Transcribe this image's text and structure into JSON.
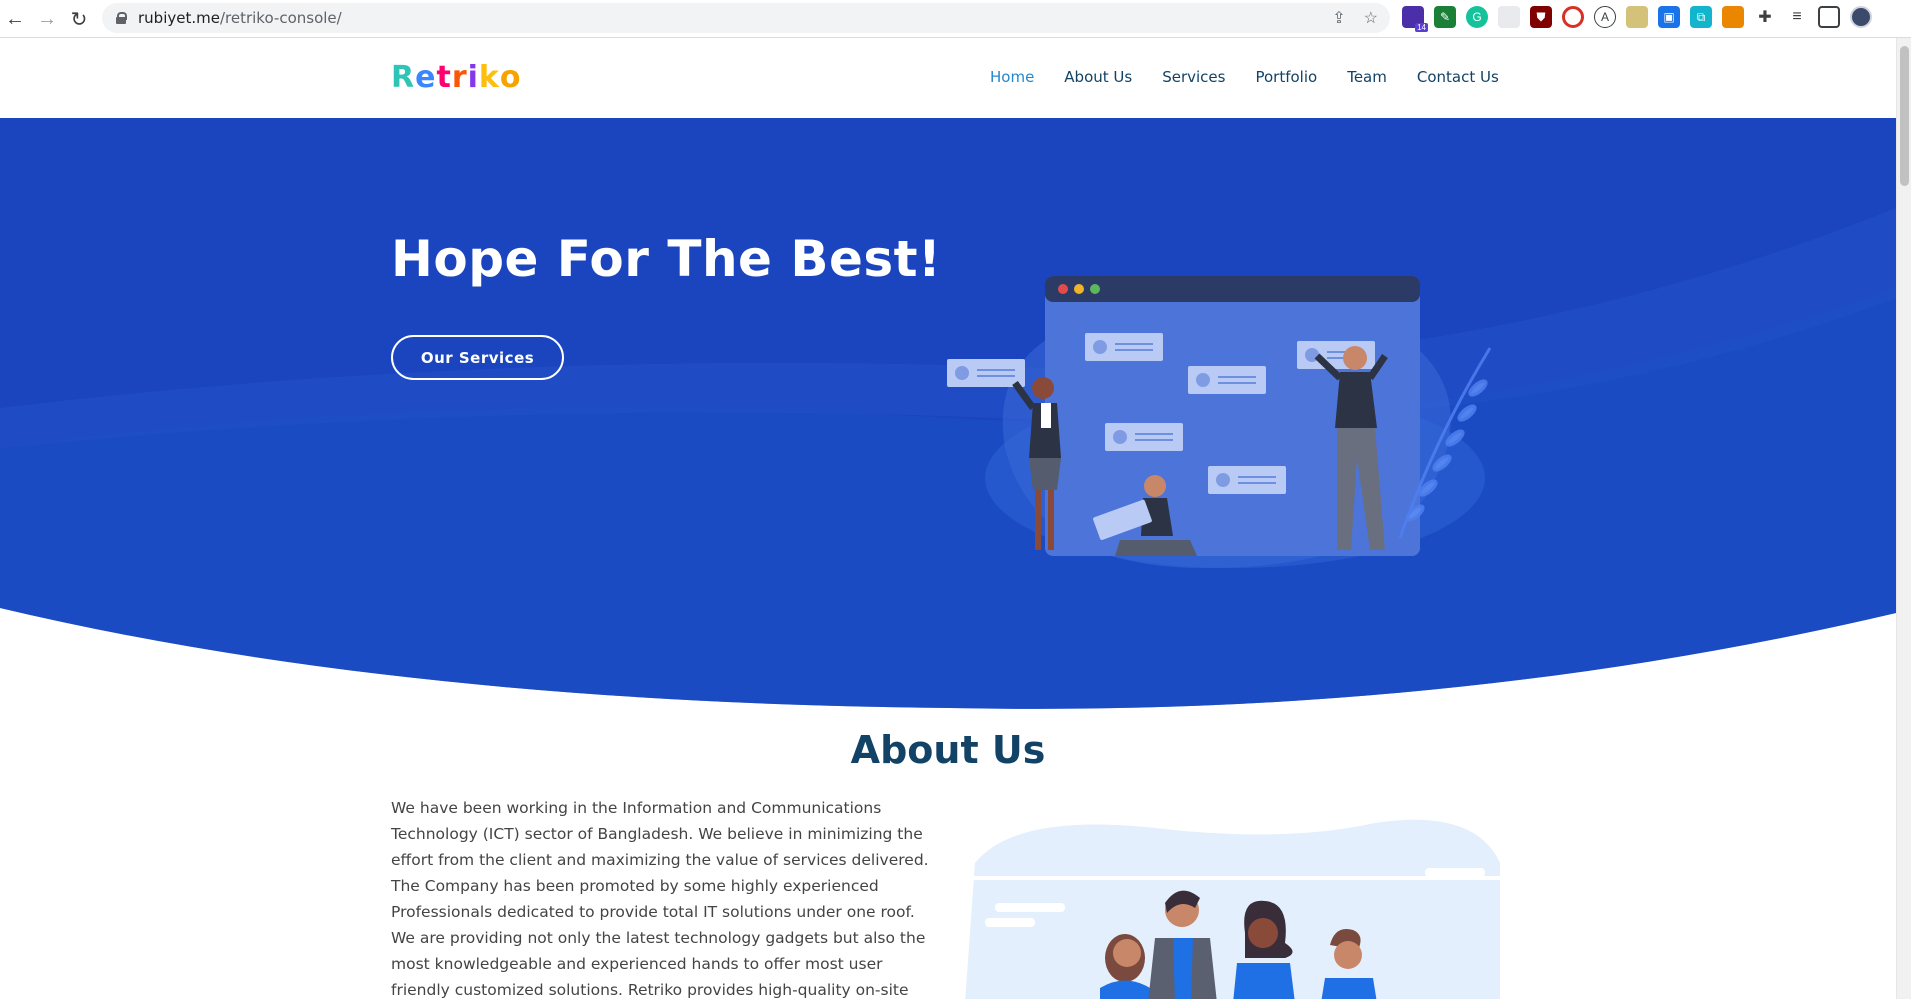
{
  "browser": {
    "url_host": "rubiyet.me",
    "url_path": "/retriko-console/",
    "extension_badge": "14"
  },
  "site": {
    "logo": "Retriko",
    "logo_colors": [
      "#2ec4b6",
      "#3a86ff",
      "#ff006e",
      "#fb5607",
      "#8338ec",
      "#ffbe0b",
      "#06d6a0"
    ],
    "nav": [
      {
        "label": "Home",
        "active": true
      },
      {
        "label": "About Us",
        "active": false
      },
      {
        "label": "Services",
        "active": false
      },
      {
        "label": "Portfolio",
        "active": false
      },
      {
        "label": "Team",
        "active": false
      },
      {
        "label": "Contact Us",
        "active": false
      }
    ],
    "hero": {
      "title": "Hope For The Best!",
      "button": "Our Services",
      "bg_color": "#1a45be"
    },
    "about": {
      "title": "About Us",
      "text": "We have been working in the Information and Communications Technology (ICT) sector of Bangladesh. We believe in minimizing the effort from the client and maximizing the value of services delivered. The Company has been promoted by some highly experienced Professionals dedicated to provide total IT solutions under one roof. We are providing not only the latest technology gadgets but also the most knowledgeable and experienced hands to offer most user friendly customized solutions. Retriko provides high-quality on-site services for"
    }
  }
}
